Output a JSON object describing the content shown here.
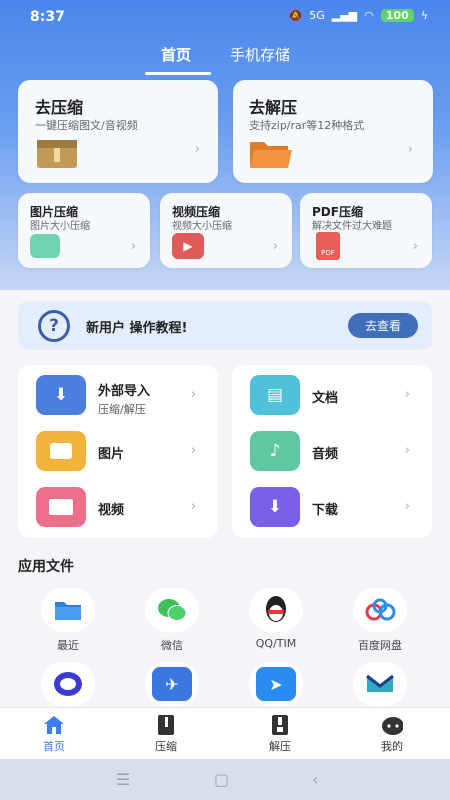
{
  "status_bar": {
    "time": "8:37",
    "network": "5G",
    "battery": "100"
  },
  "tabs": [
    {
      "label": "首页",
      "active": true
    },
    {
      "label": "手机存储",
      "active": false
    }
  ],
  "big_cards": [
    {
      "title": "去压缩",
      "subtitle": "一键压缩图文/音视频",
      "icon": "archive-box-icon"
    },
    {
      "title": "去解压",
      "subtitle": "支持zip/rar等12种格式",
      "icon": "open-folder-icon"
    }
  ],
  "small_cards": [
    {
      "title": "图片压缩",
      "subtitle": "图片大小压缩",
      "icon": "image-icon"
    },
    {
      "title": "视频压缩",
      "subtitle": "视频大小压缩",
      "icon": "video-play-icon"
    },
    {
      "title": "PDF压缩",
      "subtitle": "解决文件过大难题",
      "icon": "pdf-icon"
    }
  ],
  "banner": {
    "text": "新用户 操作教程!",
    "button": "去查看",
    "icon": "help-icon"
  },
  "left_list": [
    {
      "label": "外部导入",
      "sub": "压缩/解压",
      "color": "#4a7fe0",
      "icon": "download-icon"
    },
    {
      "label": "图片",
      "sub": "",
      "color": "#f1b33b",
      "icon": "picture-icon"
    },
    {
      "label": "视频",
      "sub": "",
      "color": "#ee6f8a",
      "icon": "video-icon"
    }
  ],
  "right_list": [
    {
      "label": "文档",
      "color": "#4fc1d8",
      "icon": "document-icon"
    },
    {
      "label": "音频",
      "color": "#5fc8a0",
      "icon": "music-icon"
    },
    {
      "label": "下载",
      "color": "#7b5ee8",
      "icon": "download-icon"
    }
  ],
  "section_title": "应用文件",
  "apps": [
    {
      "label": "最近",
      "icon": "folder-icon"
    },
    {
      "label": "微信",
      "icon": "wechat-icon"
    },
    {
      "label": "QQ/TIM",
      "icon": "qq-icon"
    },
    {
      "label": "百度网盘",
      "icon": "baidu-netdisk-icon"
    },
    {
      "label": "",
      "icon": "chat-bubble-icon"
    },
    {
      "label": "",
      "icon": "paper-plane-icon"
    },
    {
      "label": "",
      "icon": "send-icon"
    },
    {
      "label": "",
      "icon": "inbox-icon"
    }
  ],
  "bottom_nav": [
    {
      "label": "首页",
      "icon": "home-icon",
      "active": true
    },
    {
      "label": "压缩",
      "icon": "zip-file-icon",
      "active": false
    },
    {
      "label": "解压",
      "icon": "unzip-file-icon",
      "active": false
    },
    {
      "label": "我的",
      "icon": "profile-icon",
      "active": false
    }
  ],
  "colors": {
    "accent": "#3b7ff0",
    "hero": "#4a86ec"
  }
}
